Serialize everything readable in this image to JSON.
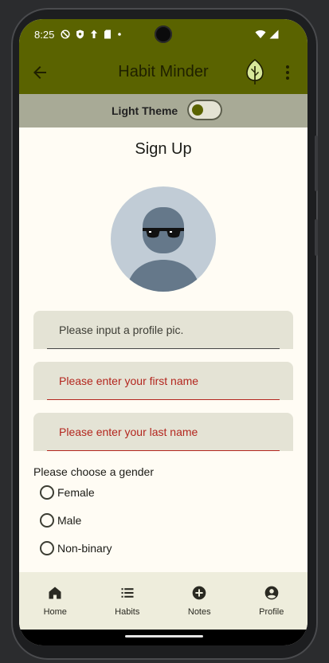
{
  "status_bar": {
    "time": "8:25"
  },
  "app_bar": {
    "title": "Habit Minder"
  },
  "theme": {
    "label": "Light Theme",
    "toggle_on": false
  },
  "page": {
    "title": "Sign Up"
  },
  "form": {
    "profile_pic_placeholder": "Please input a profile pic.",
    "first_name_placeholder": "Please enter your first name",
    "last_name_placeholder": "Please enter your last name",
    "gender_label": "Please choose a gender",
    "gender_options": [
      "Female",
      "Male",
      "Non-binary"
    ]
  },
  "bottom_nav": {
    "items": [
      {
        "label": "Home",
        "icon": "home-icon"
      },
      {
        "label": "Habits",
        "icon": "list-icon"
      },
      {
        "label": "Notes",
        "icon": "add-circle-icon"
      },
      {
        "label": "Profile",
        "icon": "account-circle-icon"
      }
    ]
  },
  "colors": {
    "primary": "#5a6300",
    "error": "#b3261e",
    "background": "#fffcf4",
    "field_fill": "#e4e3d5",
    "theme_bar": "#a8aa96"
  }
}
